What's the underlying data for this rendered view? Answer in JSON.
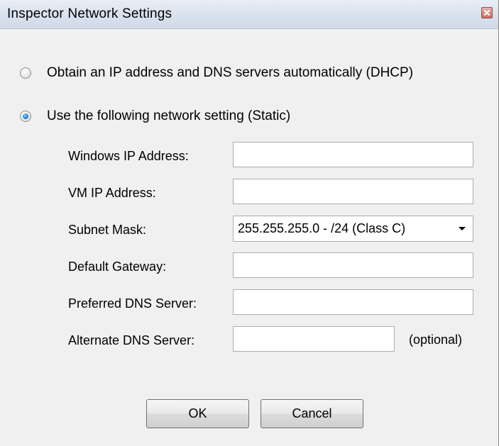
{
  "window": {
    "title": "Inspector Network Settings",
    "close_icon": "close-icon"
  },
  "mode": {
    "dhcp_label": "Obtain an IP address and DNS servers automatically (DHCP)",
    "static_label": "Use the following network setting (Static)",
    "selected": "static"
  },
  "fields": {
    "windows_ip": {
      "label": "Windows IP Address:",
      "value": ""
    },
    "vm_ip": {
      "label": "VM IP Address:",
      "value": ""
    },
    "subnet_mask": {
      "label": "Subnet Mask:",
      "value": "255.255.255.0 - /24 (Class C)"
    },
    "default_gateway": {
      "label": "Default Gateway:",
      "value": ""
    },
    "preferred_dns": {
      "label": "Preferred DNS Server:",
      "value": ""
    },
    "alternate_dns": {
      "label": "Alternate DNS Server:",
      "value": "",
      "note": "(optional)"
    }
  },
  "buttons": {
    "ok": "OK",
    "cancel": "Cancel"
  }
}
